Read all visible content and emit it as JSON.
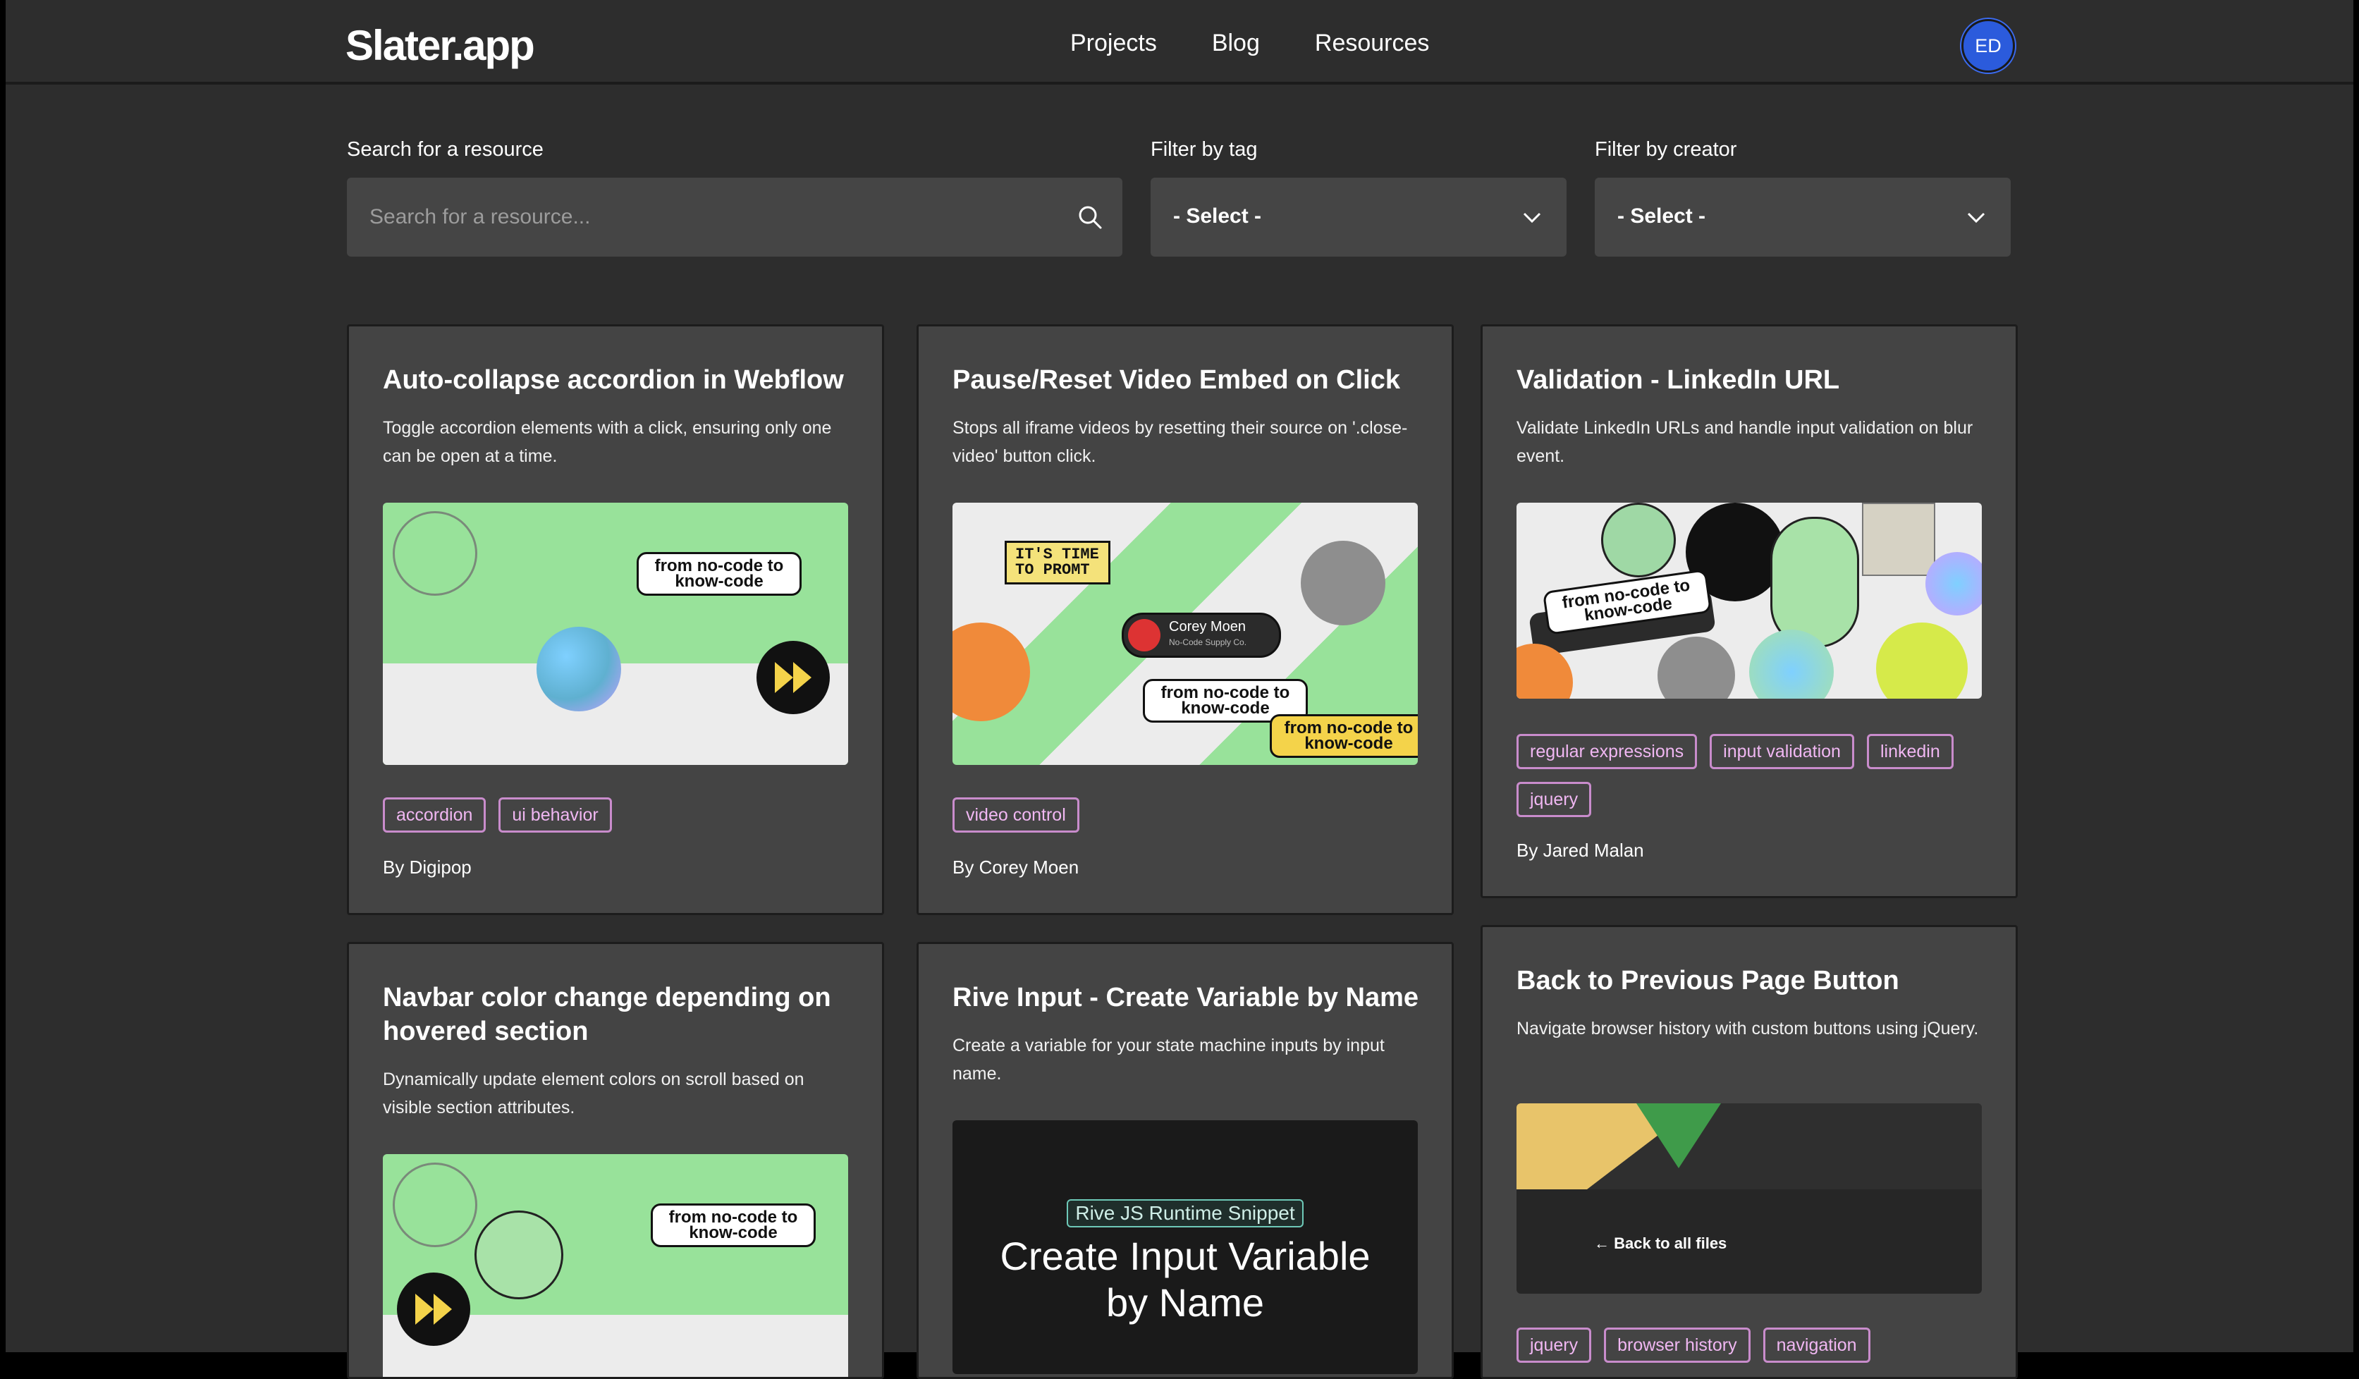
{
  "nav": {
    "logo": "Slater.app",
    "links": [
      "Projects",
      "Blog",
      "Resources"
    ],
    "avatar_initials": "ED"
  },
  "filters": {
    "search_label": "Search for a resource",
    "search_placeholder": "Search for a resource...",
    "tag_label": "Filter by tag",
    "tag_value": "- Select -",
    "creator_label": "Filter by creator",
    "creator_value": "- Select -"
  },
  "cards": [
    {
      "title": "Auto-collapse accordion in Webflow",
      "description": "Toggle accordion elements with a click, ensuring only one can be open at a time.",
      "tags": [
        "accordion",
        "ui behavior"
      ],
      "author": "By Digipop",
      "sticker_text": "from no-code to know-code"
    },
    {
      "title": "Pause/Reset Video Embed on Click",
      "description": "Stops all iframe videos by resetting their source on '.close-video' button click.",
      "tags": [
        "video control"
      ],
      "author": "By Corey Moen",
      "prompt_text": "IT'S TIME TO PROMT",
      "badge_name": "Corey Moen",
      "badge_sub": "No-Code Supply Co.",
      "sticker_text": "from no-code to know-code"
    },
    {
      "title": "Validation - LinkedIn URL",
      "description": "Validate LinkedIn URLs and handle input validation on blur event.",
      "tags": [
        "regular expressions",
        "input validation",
        "linkedin",
        "jquery"
      ],
      "author": "By Jared Malan",
      "sticker_text": "from no-code to know-code"
    },
    {
      "title": "Navbar color change depending on hovered section",
      "description": "Dynamically update element colors on scroll based on visible section attributes.",
      "tags": [],
      "author": "",
      "sticker_text": "from no-code to know-code"
    },
    {
      "title": "Rive Input - Create Variable by Name",
      "description": "Create a variable for your state machine inputs by input name.",
      "tags": [],
      "author": "",
      "thumb_badge": "Rive JS Runtime Snippet",
      "thumb_heading": "Create Input Variable by Name"
    },
    {
      "title": "Back to Previous Page Button",
      "description": "Navigate browser history with custom buttons using jQuery.",
      "tags": [
        "jquery",
        "browser history",
        "navigation"
      ],
      "author": "",
      "thumb_link": "← Back to all files"
    }
  ],
  "colors": {
    "background": "#2d2d2d",
    "card": "#444444",
    "tag_border": "#c98ccc",
    "avatar": "#2b5bdc",
    "thumb_green": "#98e29a"
  }
}
